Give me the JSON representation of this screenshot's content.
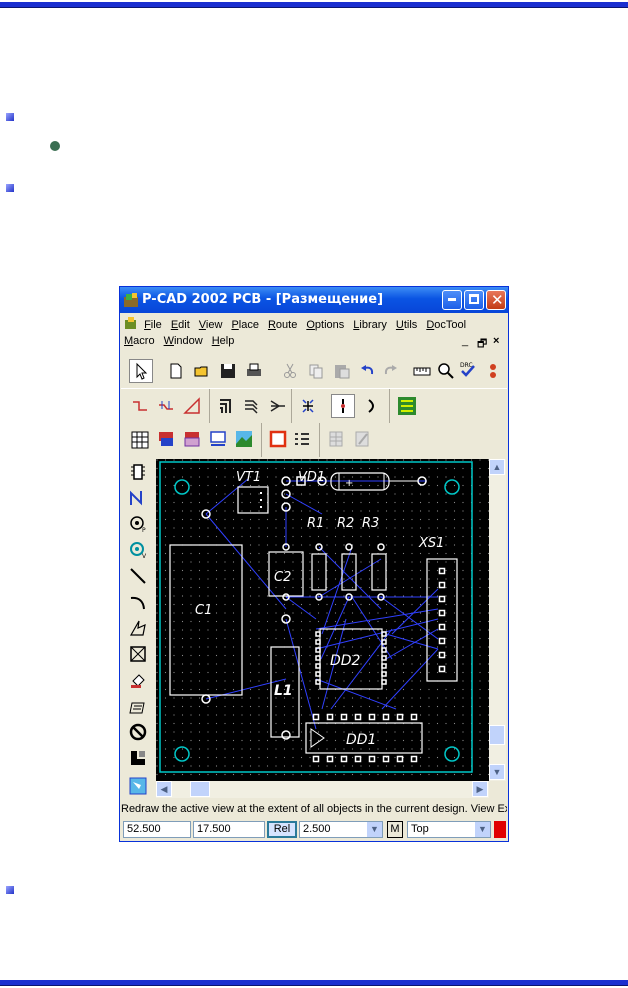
{
  "window": {
    "title": "P-CAD 2002 PCB - [Размещение]",
    "menu_row1": [
      "File",
      "Edit",
      "View",
      "Place",
      "Route",
      "Options",
      "Library",
      "Utils",
      "DocTool"
    ],
    "menu_row2": [
      "Macro",
      "Window",
      "Help"
    ],
    "status_text": "Redraw the active view at the extent of all objects in the current design. View Exter",
    "x_coord": "52.500",
    "y_coord": "17.500",
    "rel_label": "Rel",
    "grid_value": "2.500",
    "m_label": "M",
    "layer_value": "Top",
    "layer_color": "#e00000"
  },
  "board": {
    "labels": {
      "vt1": "VT1",
      "vd1": "VD1",
      "r1": "R1",
      "r2": "R2",
      "r3": "R3",
      "xs1": "XS1",
      "c2": "C2",
      "c1": "C1",
      "dd2": "DD2",
      "l1": "L1",
      "dd1": "DD1",
      "vd_plus": "+"
    },
    "colors": {
      "outline": "#00c8c8",
      "component": "#ffffff",
      "ratsnest": "#3040ff",
      "pad": "#ffffff"
    }
  },
  "icons": {
    "toolbar1": [
      "select-arrow-icon",
      "new-icon",
      "open-icon",
      "save-icon",
      "print-icon",
      "cut-icon",
      "copy-icon",
      "paste-icon",
      "undo-icon",
      "redo-icon",
      "measure-icon",
      "zoom-icon",
      "drc-icon"
    ],
    "left": [
      "component-icon",
      "route-icon",
      "pad-icon",
      "via-icon",
      "line-icon",
      "arc-icon",
      "polygon-icon",
      "keepout-icon",
      "fill-icon",
      "text-icon",
      "delete-icon",
      "copper-icon",
      "view-icon"
    ]
  }
}
